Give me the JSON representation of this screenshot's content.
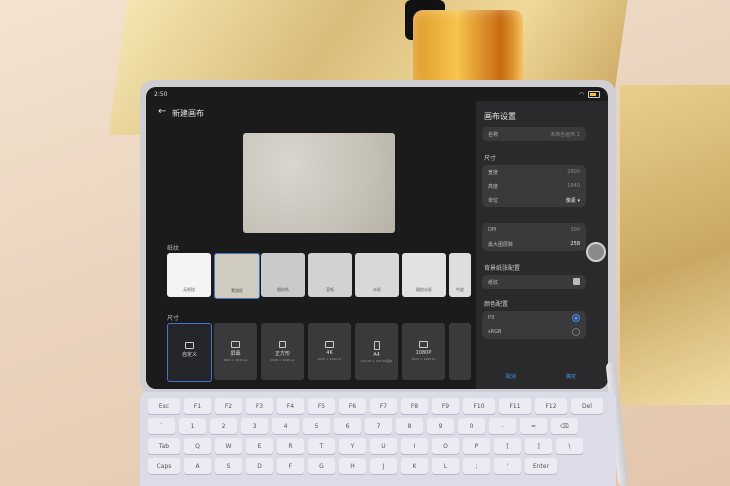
{
  "status_bar": {
    "time": "2:50"
  },
  "header": {
    "title": "新建画布"
  },
  "texture_section": {
    "label": "纸纹",
    "items": [
      {
        "label": "无纸纹"
      },
      {
        "label": "素描纸"
      },
      {
        "label": "粗纹纸"
      },
      {
        "label": "宣纸"
      },
      {
        "label": "水彩"
      },
      {
        "label": "粗纹水彩"
      },
      {
        "label": "牛皮"
      }
    ]
  },
  "size_section": {
    "label": "尺寸",
    "items": [
      {
        "label": "自定义",
        "dim": ""
      },
      {
        "label": "屏幕",
        "dim": "2800 × 1840 px"
      },
      {
        "label": "正方形",
        "dim": "2048 × 2048 px"
      },
      {
        "label": "4K",
        "dim": "4096 × 2160 px"
      },
      {
        "label": "A4",
        "dim": "210.00 × 297.00毫米"
      },
      {
        "label": "1080P",
        "dim": "1920 × 1080 px"
      }
    ]
  },
  "settings": {
    "title": "画布设置",
    "name_label": "名称",
    "name_value": "未命名画布 1",
    "size_heading": "尺寸",
    "width_label": "宽度",
    "width_value": "2800",
    "height_label": "高度",
    "height_value": "1840",
    "unit_label": "单位",
    "unit_value": "像素",
    "dpi_label": "DPI",
    "dpi_value": "300",
    "max_layers_label": "最大图层数",
    "max_layers_value": "258",
    "bg_heading": "背景纸张配置",
    "bg_label": "纸纹",
    "color_heading": "颜色配置",
    "color_p3": "P3",
    "color_srgb": "sRGB",
    "cancel": "取消",
    "ok": "确定"
  },
  "keyboard": {
    "row1": [
      "Esc",
      "F1",
      "F2",
      "F3",
      "F4",
      "F5",
      "F6",
      "F7",
      "F8",
      "F9",
      "F10",
      "F11",
      "F12",
      "Del"
    ],
    "row2": [
      "`",
      "1",
      "2",
      "3",
      "4",
      "5",
      "6",
      "7",
      "8",
      "9",
      "0",
      "-",
      "=",
      "⌫"
    ],
    "row3": [
      "Tab",
      "Q",
      "W",
      "E",
      "R",
      "T",
      "Y",
      "U",
      "I",
      "O",
      "P",
      "[",
      "]",
      "\\"
    ],
    "row4": [
      "Caps",
      "A",
      "S",
      "D",
      "F",
      "G",
      "H",
      "J",
      "K",
      "L",
      ";",
      "'",
      "Enter"
    ]
  }
}
